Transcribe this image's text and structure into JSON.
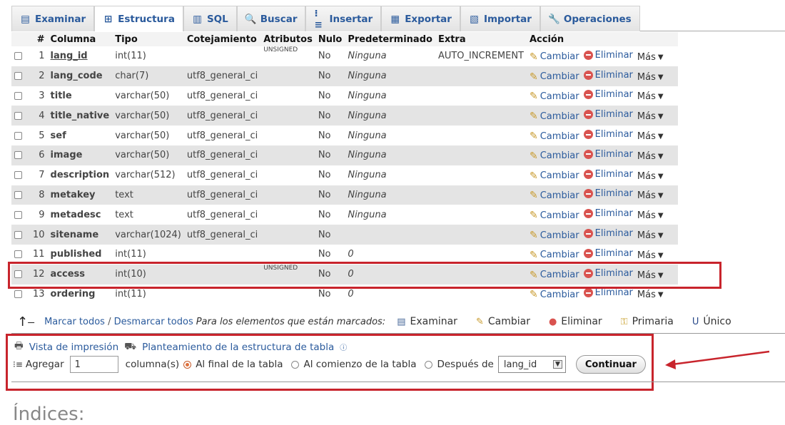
{
  "tabs": [
    {
      "label": "Examinar",
      "icon": "browse-icon",
      "active": false
    },
    {
      "label": "Estructura",
      "icon": "structure-icon",
      "active": true
    },
    {
      "label": "SQL",
      "icon": "sql-icon",
      "active": false
    },
    {
      "label": "Buscar",
      "icon": "search-icon",
      "active": false
    },
    {
      "label": "Insertar",
      "icon": "insert-icon",
      "active": false
    },
    {
      "label": "Exportar",
      "icon": "export-icon",
      "active": false
    },
    {
      "label": "Importar",
      "icon": "import-icon",
      "active": false
    },
    {
      "label": "Operaciones",
      "icon": "operations-icon",
      "active": false
    }
  ],
  "table": {
    "headers": [
      "#",
      "Columna",
      "Tipo",
      "Cotejamiento",
      "Atributos",
      "Nulo",
      "Predeterminado",
      "Extra",
      "Acción"
    ],
    "rows": [
      {
        "n": "1",
        "name": "lang_id",
        "type": "int(11)",
        "collation": "",
        "attr": "UNSIGNED",
        "null": "No",
        "default": "Ninguna",
        "extra": "AUTO_INCREMENT",
        "pk": true
      },
      {
        "n": "2",
        "name": "lang_code",
        "type": "char(7)",
        "collation": "utf8_general_ci",
        "attr": "",
        "null": "No",
        "default": "Ninguna",
        "extra": ""
      },
      {
        "n": "3",
        "name": "title",
        "type": "varchar(50)",
        "collation": "utf8_general_ci",
        "attr": "",
        "null": "No",
        "default": "Ninguna",
        "extra": ""
      },
      {
        "n": "4",
        "name": "title_native",
        "type": "varchar(50)",
        "collation": "utf8_general_ci",
        "attr": "",
        "null": "No",
        "default": "Ninguna",
        "extra": ""
      },
      {
        "n": "5",
        "name": "sef",
        "type": "varchar(50)",
        "collation": "utf8_general_ci",
        "attr": "",
        "null": "No",
        "default": "Ninguna",
        "extra": ""
      },
      {
        "n": "6",
        "name": "image",
        "type": "varchar(50)",
        "collation": "utf8_general_ci",
        "attr": "",
        "null": "No",
        "default": "Ninguna",
        "extra": ""
      },
      {
        "n": "7",
        "name": "description",
        "type": "varchar(512)",
        "collation": "utf8_general_ci",
        "attr": "",
        "null": "No",
        "default": "Ninguna",
        "extra": ""
      },
      {
        "n": "8",
        "name": "metakey",
        "type": "text",
        "collation": "utf8_general_ci",
        "attr": "",
        "null": "No",
        "default": "Ninguna",
        "extra": ""
      },
      {
        "n": "9",
        "name": "metadesc",
        "type": "text",
        "collation": "utf8_general_ci",
        "attr": "",
        "null": "No",
        "default": "Ninguna",
        "extra": ""
      },
      {
        "n": "10",
        "name": "sitename",
        "type": "varchar(1024)",
        "collation": "utf8_general_ci",
        "attr": "",
        "null": "No",
        "default": "",
        "extra": ""
      },
      {
        "n": "11",
        "name": "published",
        "type": "int(11)",
        "collation": "",
        "attr": "",
        "null": "No",
        "default": "0",
        "extra": ""
      },
      {
        "n": "12",
        "name": "access",
        "type": "int(10)",
        "collation": "",
        "attr": "UNSIGNED",
        "null": "No",
        "default": "0",
        "extra": ""
      },
      {
        "n": "13",
        "name": "ordering",
        "type": "int(11)",
        "collation": "",
        "attr": "",
        "null": "No",
        "default": "0",
        "extra": ""
      }
    ],
    "actions": {
      "change": "Cambiar",
      "delete": "Eliminar",
      "more": "Más"
    }
  },
  "bulk": {
    "check_all": "Marcar todos",
    "separator": " / ",
    "uncheck_all": "Desmarcar todos",
    "with_selected": "Para los elementos que están marcados:",
    "actions": [
      {
        "label": "Examinar",
        "icon": "browse-icon"
      },
      {
        "label": "Cambiar",
        "icon": "pencil-icon"
      },
      {
        "label": "Eliminar",
        "icon": "delete-icon"
      },
      {
        "label": "Primaria",
        "icon": "key-icon"
      },
      {
        "label": "Único",
        "icon": "unique-icon"
      }
    ]
  },
  "links": {
    "print_view": "Vista de impresión",
    "propose": "Planteamiento de la estructura de tabla"
  },
  "add": {
    "label": "Agregar",
    "count": "1",
    "columns": "columna(s)",
    "at_end": "Al final de la tabla",
    "at_start": "Al comienzo de la tabla",
    "after": "Después de",
    "after_col": "lang_id",
    "go": "Continuar"
  },
  "indices_title": "Índices:",
  "colors": {
    "highlight": "#c8242c",
    "link": "#2a5a9c"
  }
}
